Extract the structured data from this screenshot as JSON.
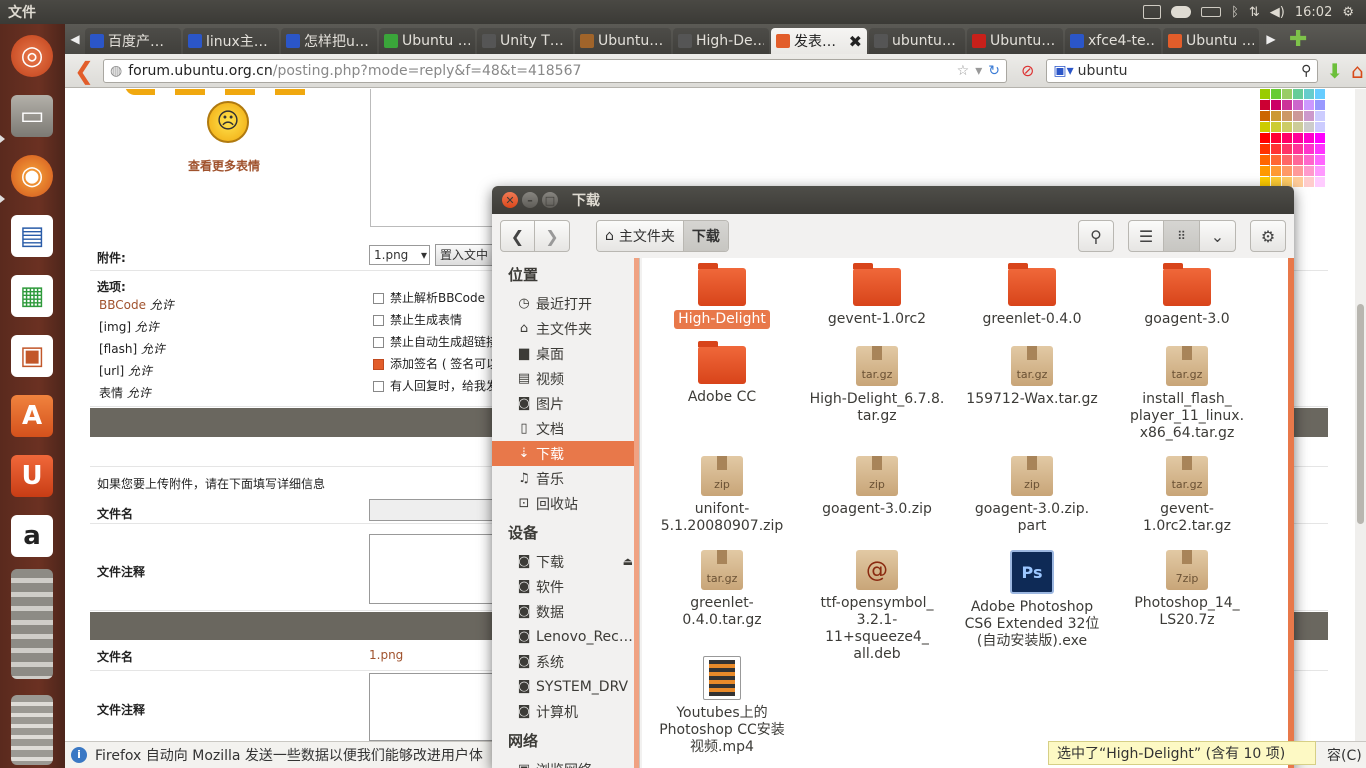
{
  "topbar": {
    "app_menu": "文件",
    "time": "16:02"
  },
  "tabs": [
    {
      "label": "百度产…",
      "color": "#2b56c8"
    },
    {
      "label": "linux主…",
      "color": "#2b56c8"
    },
    {
      "label": "怎样把u…",
      "color": "#2b56c8"
    },
    {
      "label": "Ubuntu …",
      "color": "#3aa53a"
    },
    {
      "label": "Unity T…",
      "color": "#555555"
    },
    {
      "label": "Ubuntu…",
      "color": "#a0642a"
    },
    {
      "label": "High-De…",
      "color": "#555555"
    },
    {
      "label": "发表…",
      "color": "#e25d2a",
      "active": true
    },
    {
      "label": "ubuntu…",
      "color": "#555555"
    },
    {
      "label": "Ubuntu…",
      "color": "#c8201a"
    },
    {
      "label": "xfce4-te…",
      "color": "#2b56c8"
    },
    {
      "label": "Ubuntu …",
      "color": "#e25d2a"
    }
  ],
  "nav": {
    "url_host": "forum.ubuntu.org.cn",
    "url_path": "/posting.php?mode=reply&f=48&t=418567",
    "search_value": "ubuntu"
  },
  "page": {
    "more_smilies": "查看更多表情",
    "attach_label": "附件:",
    "attach_select": "1.png",
    "insert_btn": "置入文中",
    "options_label": "选项:",
    "left_options": [
      {
        "name": "BBCode",
        "state": "允许"
      },
      {
        "name": "[img]",
        "state": "允许"
      },
      {
        "name": "[flash]",
        "state": "允许"
      },
      {
        "name": "[url]",
        "state": "允许"
      },
      {
        "name": "表情",
        "state": "允许"
      }
    ],
    "checks": [
      {
        "label": "禁止解析BBCode",
        "checked": false
      },
      {
        "label": "禁止生成表情",
        "checked": false
      },
      {
        "label": "禁止自动生成超链接",
        "checked": false
      },
      {
        "label": "添加签名 ( 签名可以",
        "checked": true
      },
      {
        "label": "有人回复时，给我发",
        "checked": false
      }
    ],
    "upload_hint": "如果您要上传附件，请在下面填写详细信息",
    "filename_label": "文件名",
    "comment_label": "文件注释",
    "filename_label2": "文件名",
    "filename_value": "1.png",
    "comment_label2": "文件注释"
  },
  "status": {
    "text": "Firefox 自动向 Mozilla 发送一些数据以便我们能够改进用户体",
    "tail": "容(C)"
  },
  "dialog": {
    "title": "下载",
    "crumb_home": "主文件夹",
    "crumb_current": "下载",
    "places_title": "位置",
    "places": [
      {
        "icon": "clock-icon",
        "glyph": "◷",
        "label": "最近打开"
      },
      {
        "icon": "home-icon",
        "glyph": "⌂",
        "label": "主文件夹"
      },
      {
        "icon": "folder-icon",
        "glyph": "▆",
        "label": "桌面"
      },
      {
        "icon": "film-icon",
        "glyph": "▤",
        "label": "视频"
      },
      {
        "icon": "camera-icon",
        "glyph": "◙",
        "label": "图片"
      },
      {
        "icon": "document-icon",
        "glyph": "▯",
        "label": "文档"
      },
      {
        "icon": "download-icon",
        "glyph": "⇣",
        "label": "下载",
        "selected": true
      },
      {
        "icon": "music-icon",
        "glyph": "♫",
        "label": "音乐"
      },
      {
        "icon": "trash-icon",
        "glyph": "⊡",
        "label": "回收站"
      }
    ],
    "devices_title": "设备",
    "devices": [
      {
        "label": "下载",
        "eject": true
      },
      {
        "label": "软件"
      },
      {
        "label": "数据"
      },
      {
        "label": "Lenovo_Rec…"
      },
      {
        "label": "系统"
      },
      {
        "label": "SYSTEM_DRV"
      },
      {
        "label": "计算机"
      }
    ],
    "network_title": "网络",
    "network_item": "浏览网络",
    "files": [
      {
        "kind": "folder",
        "name": "High-Delight",
        "selected": true
      },
      {
        "kind": "folder",
        "name": "gevent-1.0rc2"
      },
      {
        "kind": "folder",
        "name": "greenlet-0.4.0"
      },
      {
        "kind": "folder",
        "name": "goagent-3.0"
      },
      {
        "kind": "folder",
        "name": "Adobe CC"
      },
      {
        "kind": "archive",
        "badge": "tar.gz",
        "name": "High-Delight_6.7.8.\ntar.gz"
      },
      {
        "kind": "archive",
        "badge": "tar.gz",
        "name": "159712-Wax.tar.gz"
      },
      {
        "kind": "archive",
        "badge": "tar.gz",
        "name": "install_flash_\nplayer_11_linux.\nx86_64.tar.gz"
      },
      {
        "kind": "archive",
        "badge": "zip",
        "name": "unifont-\n5.1.20080907.zip"
      },
      {
        "kind": "archive",
        "badge": "zip",
        "name": "goagent-3.0.zip"
      },
      {
        "kind": "archive",
        "badge": "zip",
        "name": "goagent-3.0.zip.\npart"
      },
      {
        "kind": "archive",
        "badge": "tar.gz",
        "name": "gevent-1.0rc2.tar.gz"
      },
      {
        "kind": "archive",
        "badge": "tar.gz",
        "name": "greenlet-0.4.0.tar.gz"
      },
      {
        "kind": "deb",
        "name": "ttf-opensymbol_\n3.2.1-11+squeeze4_\nall.deb"
      },
      {
        "kind": "ps",
        "badge": "Ps",
        "name": "Adobe Photoshop\nCS6 Extended 32位\n(自动安装版).exe"
      },
      {
        "kind": "archive",
        "badge": "7zip",
        "name": "Photoshop_14_\nLS20.7z"
      },
      {
        "kind": "video",
        "name": "Youtubes上的\nPhotoshop CC安装\n视频.mp4"
      }
    ],
    "selection_status": "选中了“High-Delight” (含有 10 项)"
  }
}
